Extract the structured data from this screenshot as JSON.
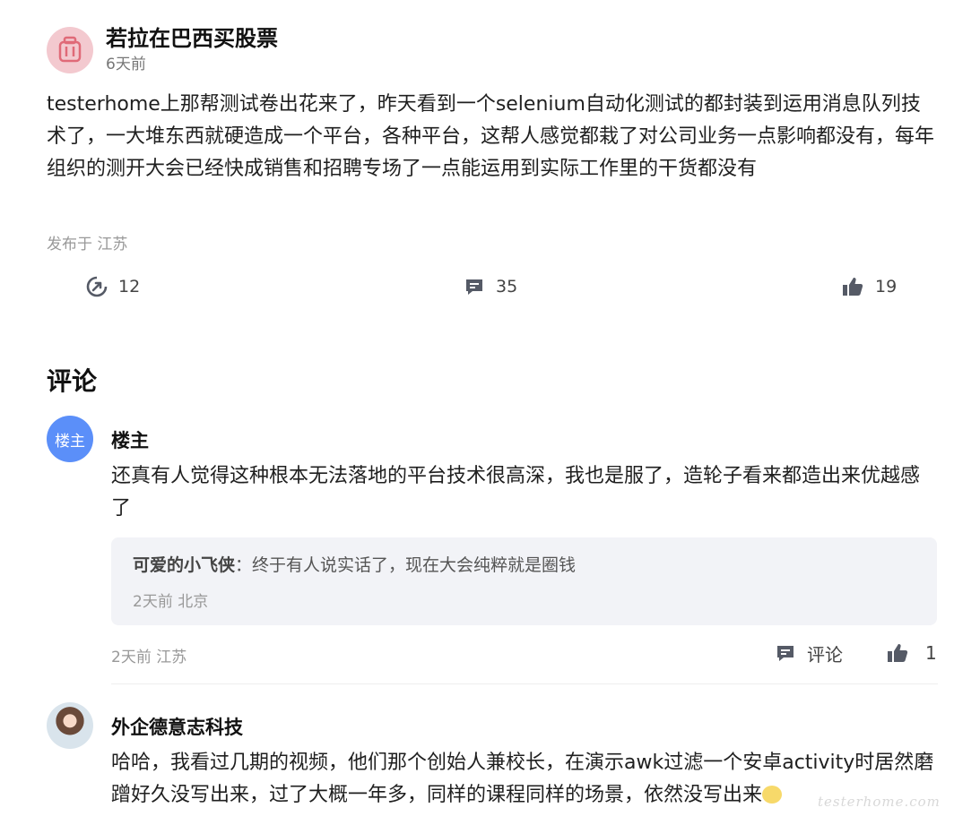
{
  "post": {
    "author": "若拉在巴西买股票",
    "time": "6天前",
    "content": "testerhome上那帮测试卷出花来了，昨天看到一个selenium自动化测试的都封装到运用消息队列技术了，一大堆东西就硬造成一个平台，各种平台，这帮人感觉都栽了对公司业务一点影响都没有，每年组织的测开大会已经快成销售和招聘专场了一点能运用到实际工作里的干货都没有",
    "location": "发布于 江苏",
    "stats": {
      "forwards": "12",
      "comments": "35",
      "likes": "19"
    }
  },
  "comments_section": {
    "title": "评论",
    "items": [
      {
        "avatar_label": "楼主",
        "name": "楼主",
        "text": "还真有人觉得这种根本无法落地的平台技术很高深，我也是服了，造轮子看来都造出来优越感了",
        "reply": {
          "author": "可爱的小飞侠",
          "separator": "：",
          "text": "终于有人说实话了，现在大会纯粹就是圈钱",
          "meta": "2天前 北京"
        },
        "meta": "2天前 江苏",
        "comment_label": "评论",
        "likes": "1"
      },
      {
        "name": "外企德意志科技",
        "text": "哈哈，我看过几期的视频，他们那个创始人兼校长，在演示awk过滤一个安卓activity时居然磨蹭好久没写出来，过了大概一年多，同样的课程同样的场景，依然没写出来"
      }
    ]
  },
  "watermark": "testerhome.com",
  "colors": {
    "avatar_bg": "#f3c9cf",
    "avatar_icon": "#e06a78",
    "host_avatar": "#5b8ff9",
    "reply_bg": "#f2f3f7",
    "icon": "#555a66"
  }
}
